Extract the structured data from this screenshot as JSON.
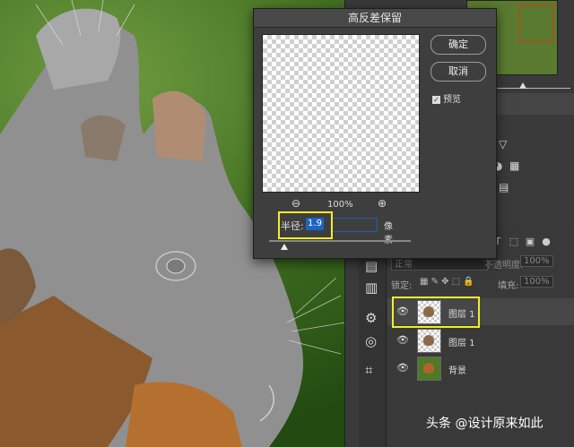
{
  "dialog": {
    "title": "高反差保留",
    "ok_label": "确定",
    "cancel_label": "取消",
    "preview_label": "预览",
    "preview_checked": true,
    "zoom_level": "100%",
    "radius_label": "半径:",
    "radius_value": "1.9",
    "radius_unit": "像素"
  },
  "layers": {
    "blend_mode": "正常",
    "opacity_label": "不透明度:",
    "opacity_value": "100%",
    "lock_label": "锁定:",
    "fill_label": "填充:",
    "fill_value": "100%",
    "items": [
      {
        "name": "图层 1",
        "selected": true
      },
      {
        "name": "图层 1",
        "selected": false
      },
      {
        "name": "背景",
        "selected": false
      }
    ]
  },
  "watermark": "头条 @设计原来如此",
  "colors": {
    "highlight": "#f2ee2a",
    "selection_blue": "#1f64c2",
    "nav_frame": "#d6371e"
  }
}
